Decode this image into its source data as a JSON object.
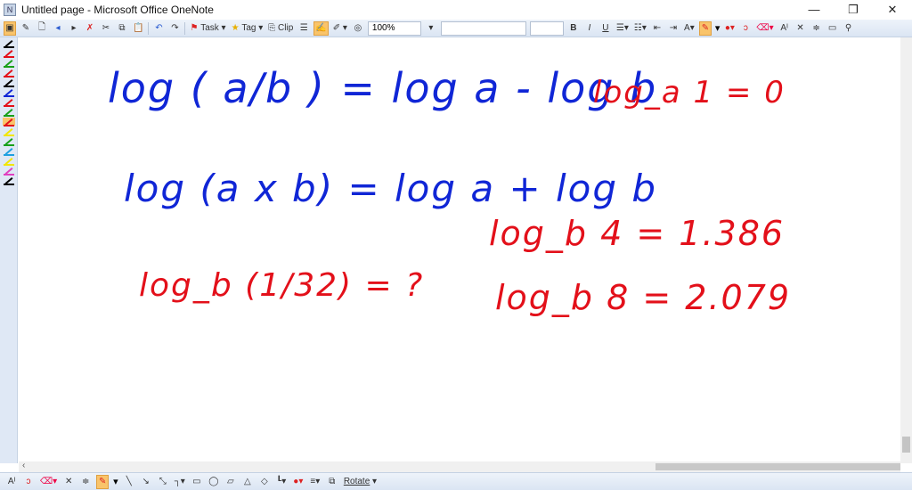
{
  "window": {
    "title": "Untitled page - Microsoft Office OneNote",
    "minimize": "—",
    "restore": "❐",
    "close": "✕"
  },
  "toolbar": {
    "task_label": "Task",
    "tag_label": "Tag",
    "clip_label": "Clip",
    "zoom_value": "100%",
    "font_name": "",
    "font_size": "",
    "bold": "B",
    "italic": "I",
    "underline": "U"
  },
  "pen_colors": [
    "#000000",
    "#e3101a",
    "#18a018",
    "#e3101a",
    "#000000",
    "#1026d6",
    "#e3101a",
    "#18a018",
    "#e3101a",
    "#f2e600",
    "#18a018",
    "#1fa0e0",
    "#f2e600",
    "#e040c0",
    "#000000"
  ],
  "ink": {
    "line1": "log ( a/b ) = log a - log b",
    "line2": "log_a 1 = 0",
    "line3": "log (a x b) = log a + log b",
    "line4": "log_b 4 = 1.386",
    "line5": "log_b (1/32) = ?",
    "line6": "log_b 8 = 2.079",
    "colors": {
      "blue": "#1026d6",
      "red": "#e3101a"
    }
  },
  "bottom_toolbar": {
    "rotate_label": "Rotate"
  }
}
